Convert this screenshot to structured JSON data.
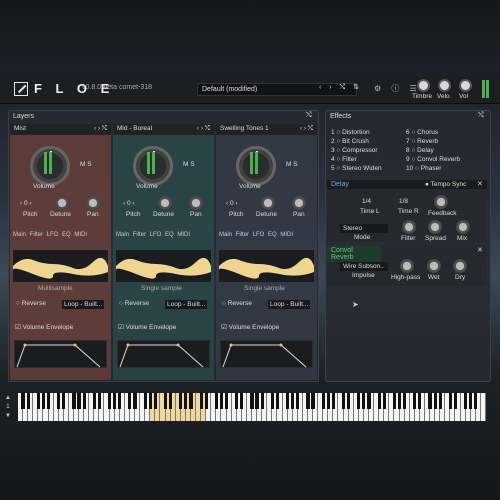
{
  "header": {
    "brand": "F L O E",
    "version": "v0.8.0-beta  comet-318",
    "preset": "Default (modified)",
    "knobs": [
      "Timbre",
      "Velo",
      "Vol"
    ]
  },
  "layers": {
    "title": "Layers",
    "items": [
      {
        "name": "Mist",
        "color": "#8a4a3e",
        "voice": "Volume",
        "small": [
          "Pitch",
          "Detune",
          "Pan"
        ],
        "pitch": "0",
        "source": "Multisample",
        "loop": "Loop - Built...",
        "reverse": "Reverse",
        "env": "Volume Envelope"
      },
      {
        "name": "Mid - Boreal",
        "color": "#2e5a56",
        "voice": "Volume",
        "small": [
          "Pitch",
          "Detune",
          "Pan"
        ],
        "pitch": "0",
        "source": "Single sample",
        "loop": "Loop - Built...",
        "reverse": "Reverse",
        "env": "Volume Envelope"
      },
      {
        "name": "Swelling Tones 1",
        "color": "#3c4654",
        "voice": "Volume",
        "small": [
          "Pitch",
          "Detune",
          "Pan"
        ],
        "pitch": "0",
        "source": "Single sample",
        "loop": "Loop - Built...",
        "reverse": "Reverse",
        "env": "Volume Envelope"
      }
    ],
    "tabs": "Main  Filter  LFO  EQ  MIDI",
    "ms": "M  S"
  },
  "effects": {
    "title": "Effects",
    "list": [
      [
        "1",
        "Distortion",
        "6",
        "Chorus"
      ],
      [
        "2",
        "Bit Crush",
        "7",
        "Reverb"
      ],
      [
        "3",
        "Compressor",
        "8",
        "Delay"
      ],
      [
        "4",
        "Filter",
        "9",
        "Convol Reverb"
      ],
      [
        "5",
        "Stereo Widen",
        "10",
        "Phaser"
      ]
    ],
    "delay": {
      "title": "Delay",
      "sync": "Tempo Sync",
      "time_l": "1/4",
      "time_r": "1/8",
      "time_l_label": "Time L",
      "time_r_label": "Time R",
      "feedback": "Feedback",
      "mode": "Stereo",
      "mode_label": "Mode",
      "filter": "Filter",
      "spread": "Spread",
      "mix": "Mix"
    },
    "convol": {
      "title": "Convol Reverb",
      "impulse": "Wire Subson..",
      "impulse_label": "Impulse",
      "highpass": "High-pass",
      "wet": "Wet",
      "dry": "Dry"
    }
  },
  "keyboard": {
    "octave": "1"
  }
}
